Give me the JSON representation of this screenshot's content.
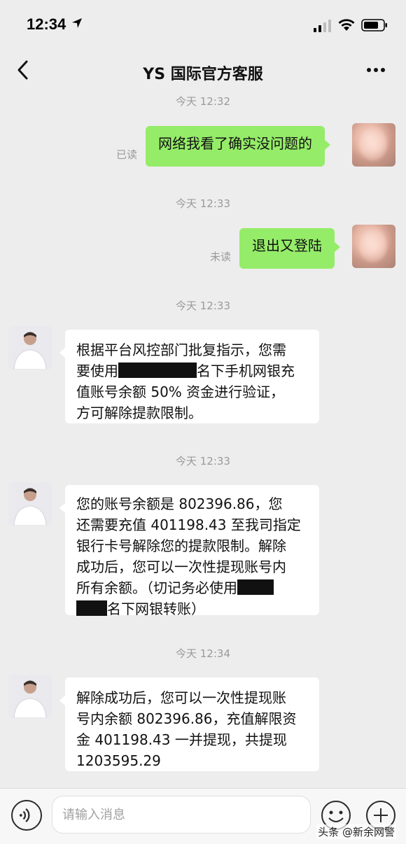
{
  "status_bar": {
    "time": "12:34"
  },
  "header": {
    "title": "YS 国际官方客服"
  },
  "messages": [
    {
      "timestamp": "今天 12:32",
      "side": "right",
      "status": "已读",
      "lines": [
        "网络我看了确实没问题的"
      ]
    },
    {
      "timestamp": "今天 12:33",
      "side": "right",
      "status": "未读",
      "lines": [
        "退出又登陆"
      ]
    },
    {
      "timestamp": "今天 12:33",
      "side": "left",
      "lines": [
        "根据平台风控部门批复指示，您需",
        "要使用",
        "名下手机网银充",
        "值账号余额 50% 资金进行验证，",
        "方可解除提款限制。"
      ]
    },
    {
      "timestamp": "今天 12:33",
      "side": "left",
      "lines": [
        "您的账号余额是 802396.86，您",
        "还需要充值 401198.43 至我司指定",
        "银行卡号解除您的提款限制。解除",
        "成功后，您可以一次性提现账号内",
        "所有余额。（切记务必使用",
        "名下网银转账）"
      ]
    },
    {
      "timestamp": "今天 12:34",
      "side": "left",
      "lines": [
        "解除成功后，您可以一次性提现账",
        "号内余额 802396.86，充值解限资",
        "金 401198.43 一并提现，共提现",
        "1203595.29"
      ]
    }
  ],
  "input": {
    "placeholder": "请输入消息"
  },
  "watermark": "头条 @新余网警",
  "colors": {
    "background": "#ededed",
    "sent_bubble": "#95ec69",
    "received_bubble": "#ffffff"
  }
}
